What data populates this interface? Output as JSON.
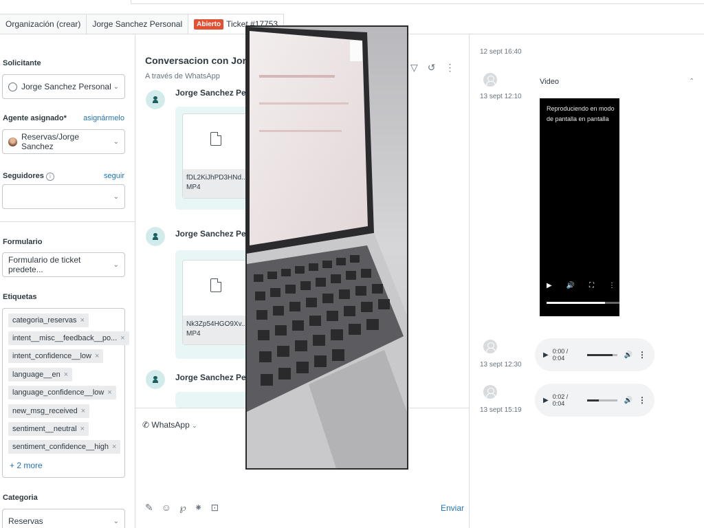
{
  "tabs": [
    {
      "label": "Organización (crear)"
    },
    {
      "label": "Jorge Sanchez Personal"
    },
    {
      "badge": "Abierto",
      "label": "Ticket #17753"
    }
  ],
  "sidebar": {
    "requester": {
      "label": "Solicitante",
      "value": "Jorge Sanchez Personal"
    },
    "assignee": {
      "label": "Agente asignado*",
      "link": "asignármelo",
      "value": "Reservas/Jorge Sanchez"
    },
    "followers": {
      "label": "Seguidores",
      "link": "seguir",
      "value": ""
    },
    "form": {
      "label": "Formulario",
      "value": "Formulario de ticket predete..."
    },
    "tags": {
      "label": "Etiquetas",
      "items": [
        "categoria_reservas",
        "intent__misc__feedback__po...",
        "intent_confidence__low",
        "language__en",
        "language_confidence__low",
        "new_msg_received",
        "sentiment__neutral",
        "sentiment_confidence__high"
      ],
      "more": "+ 2 more"
    },
    "category": {
      "label": "Categoria",
      "value": "Reservas"
    }
  },
  "conversation": {
    "title": "Conversacion con Jorge Sa",
    "subtitle": "A través de WhatsApp",
    "messages": [
      {
        "sender": "Jorge Sanchez Perso",
        "file_name": "fDL2KiJhPD3HNd...",
        "file_type": "MP4"
      },
      {
        "sender": "Jorge Sanchez Perso",
        "file_name": "Nk3Zp54HGO9Xv...",
        "file_type": "MP4"
      },
      {
        "sender": "Jorge Sanchez Perso"
      }
    ],
    "composer": {
      "channel": "WhatsApp",
      "send_label": "Enviar"
    }
  },
  "media_panel": {
    "timestamps": [
      "12 sept 16:40",
      "13 sept 12:10",
      "13 sept 12:30",
      "13 sept 15:19"
    ],
    "video": {
      "label": "Video",
      "overlay_text": "Reproduciendo en modo de pantalla en pantalla",
      "progress": 0.8
    },
    "audios": [
      {
        "time": "0:00 / 0:04",
        "progress": 0.85
      },
      {
        "time": "0:02 / 0:04",
        "progress": 0.4
      }
    ]
  },
  "pip_window": {
    "content": "laptop-video-frame"
  }
}
